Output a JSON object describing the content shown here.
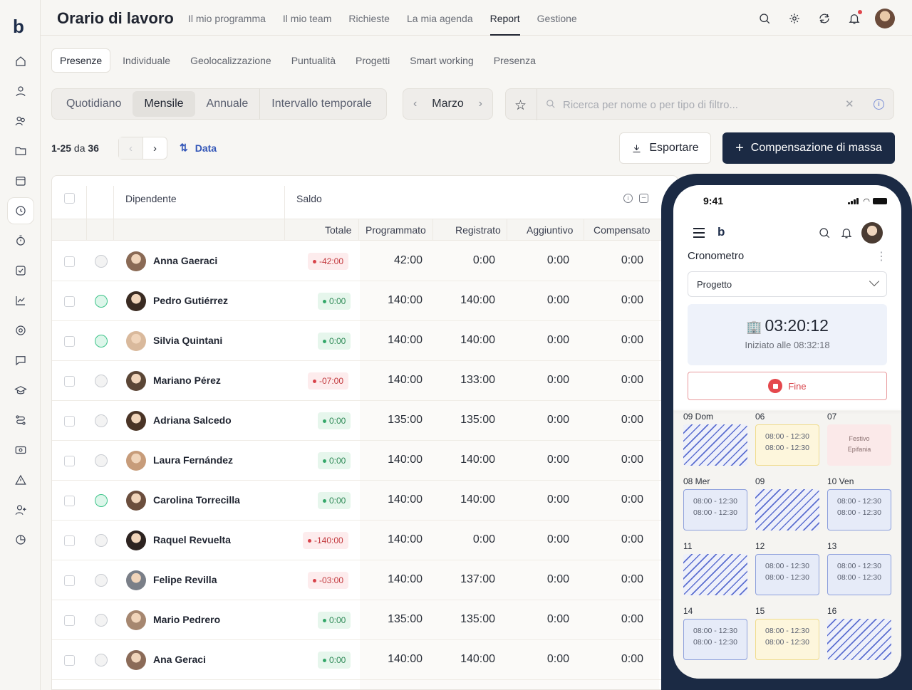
{
  "app": {
    "logo": "b",
    "title": "Orario di lavoro"
  },
  "topnav": [
    {
      "label": "Il mio programma"
    },
    {
      "label": "Il mio team"
    },
    {
      "label": "Richieste"
    },
    {
      "label": "La mia agenda"
    },
    {
      "label": "Report",
      "active": true
    },
    {
      "label": "Gestione"
    }
  ],
  "top_icons": [
    "search-icon",
    "gear-icon",
    "sync-icon",
    "bell-icon"
  ],
  "subtabs": [
    {
      "label": "Presenze",
      "active": true
    },
    {
      "label": "Individuale"
    },
    {
      "label": "Geolocalizzazione"
    },
    {
      "label": "Puntualità"
    },
    {
      "label": "Progetti"
    },
    {
      "label": "Smart working"
    },
    {
      "label": "Presenza"
    }
  ],
  "periods": [
    {
      "label": "Quotidiano"
    },
    {
      "label": "Mensile",
      "active": true
    },
    {
      "label": "Annuale"
    },
    {
      "label": "Intervallo temporale"
    }
  ],
  "month": "Marzo",
  "search": {
    "placeholder": "Ricerca per nome o per tipo di filtro..."
  },
  "pager": {
    "range": "1-25",
    "of": "da",
    "total": "36"
  },
  "sort": {
    "label": "Data"
  },
  "actions": {
    "export": "Esportare",
    "mass": "Compensazione di massa"
  },
  "table": {
    "header": {
      "employee": "Dipendente",
      "balance": "Saldo"
    },
    "subheader": {
      "total": "Totale",
      "scheduled": "Programmato",
      "recorded": "Registrato",
      "additional": "Aggiuntivo",
      "compensated": "Compensato"
    },
    "rows": [
      {
        "name": "Anna Gaeraci",
        "status": "grey",
        "balance": "-42:00",
        "sign": "neg",
        "scheduled": "42:00",
        "recorded": "0:00",
        "additional": "0:00",
        "compensated": "0:00"
      },
      {
        "name": "Pedro Gutiérrez",
        "status": "green",
        "balance": "0:00",
        "sign": "pos",
        "scheduled": "140:00",
        "recorded": "140:00",
        "additional": "0:00",
        "compensated": "0:00"
      },
      {
        "name": "Silvia Quintani",
        "status": "green",
        "balance": "0:00",
        "sign": "pos",
        "scheduled": "140:00",
        "recorded": "140:00",
        "additional": "0:00",
        "compensated": "0:00"
      },
      {
        "name": "Mariano Pérez",
        "status": "grey",
        "balance": "-07:00",
        "sign": "neg",
        "scheduled": "140:00",
        "recorded": "133:00",
        "additional": "0:00",
        "compensated": "0:00"
      },
      {
        "name": "Adriana Salcedo",
        "status": "grey",
        "balance": "0:00",
        "sign": "pos",
        "scheduled": "135:00",
        "recorded": "135:00",
        "additional": "0:00",
        "compensated": "0:00"
      },
      {
        "name": "Laura Fernández",
        "status": "grey",
        "balance": "0:00",
        "sign": "pos",
        "scheduled": "140:00",
        "recorded": "140:00",
        "additional": "0:00",
        "compensated": "0:00"
      },
      {
        "name": "Carolina Torrecilla",
        "status": "green",
        "balance": "0:00",
        "sign": "pos",
        "scheduled": "140:00",
        "recorded": "140:00",
        "additional": "0:00",
        "compensated": "0:00"
      },
      {
        "name": "Raquel Revuelta",
        "status": "grey",
        "balance": "-140:00",
        "sign": "neg",
        "scheduled": "140:00",
        "recorded": "0:00",
        "additional": "0:00",
        "compensated": "0:00"
      },
      {
        "name": "Felipe Revilla",
        "status": "grey",
        "balance": "-03:00",
        "sign": "neg",
        "scheduled": "140:00",
        "recorded": "137:00",
        "additional": "0:00",
        "compensated": "0:00"
      },
      {
        "name": "Mario Pedrero",
        "status": "grey",
        "balance": "0:00",
        "sign": "pos",
        "scheduled": "135:00",
        "recorded": "135:00",
        "additional": "0:00",
        "compensated": "0:00"
      },
      {
        "name": "Ana Geraci",
        "status": "grey",
        "balance": "0:00",
        "sign": "pos",
        "scheduled": "140:00",
        "recorded": "140:00",
        "additional": "0:00",
        "compensated": "0:00"
      }
    ]
  },
  "phone": {
    "time": "9:41",
    "logo": "b",
    "title": "Cronometro",
    "select": "Progetto",
    "timer": "03:20:12",
    "started": "Iniziato alle 08:32:18",
    "stop": "Fine",
    "days": [
      {
        "label": "09 Dom",
        "kind": "hatch"
      },
      {
        "label": "06",
        "kind": "yellow",
        "slots": [
          "08:00 - 12:30",
          "08:00 - 12:30"
        ]
      },
      {
        "label": "07",
        "kind": "pink",
        "note": [
          "Festivo",
          "Epifania"
        ]
      },
      {
        "label": "08 Mer",
        "kind": "blue",
        "slots": [
          "08:00 - 12:30",
          "08:00 - 12:30"
        ]
      },
      {
        "label": "09",
        "kind": "hatch"
      },
      {
        "label": "10 Ven",
        "kind": "blue",
        "slots": [
          "08:00 - 12:30",
          "08:00 - 12:30"
        ]
      },
      {
        "label": "11",
        "kind": "hatch"
      },
      {
        "label": "12",
        "kind": "blue",
        "slots": [
          "08:00 - 12:30",
          "08:00 - 12:30"
        ]
      },
      {
        "label": "13",
        "kind": "blue",
        "slots": [
          "08:00 - 12:30",
          "08:00 - 12:30"
        ]
      },
      {
        "label": "14",
        "kind": "blue",
        "slots": [
          "08:00 - 12:30",
          "08:00 - 12:30"
        ]
      },
      {
        "label": "15",
        "kind": "yellow",
        "slots": [
          "08:00 - 12:30",
          "08:00 - 12:30"
        ]
      },
      {
        "label": "16",
        "kind": "hatch"
      }
    ]
  },
  "colors": {
    "primary": "#1b2a44",
    "accent": "#3457b8",
    "positive": "#35a86a",
    "negative": "#d8434a"
  }
}
